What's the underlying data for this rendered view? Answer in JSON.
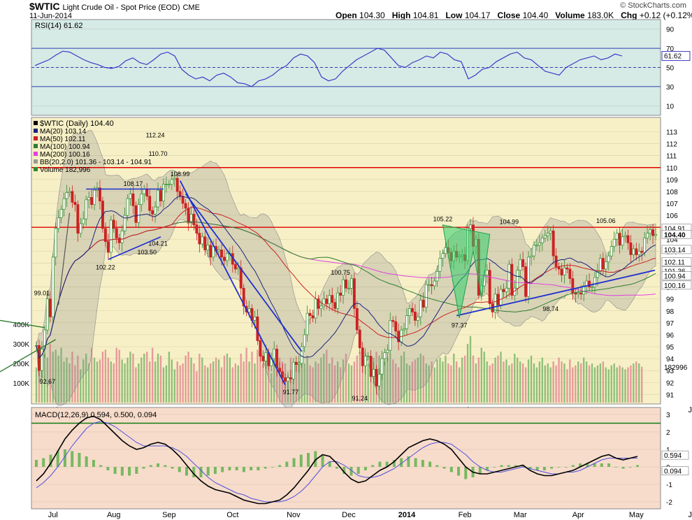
{
  "header": {
    "symbol": "$WTIC",
    "name": "Light Crude Oil - Spot Price (EOD)",
    "exchange": "CME",
    "date": "11-Jun-2014",
    "open_label": "Open",
    "open": "104.30",
    "high_label": "High",
    "high": "104.81",
    "low_label": "Low",
    "low": "104.17",
    "close_label": "Close",
    "close": "104.40",
    "volume_label": "Volume",
    "volume": "183.0K",
    "chg_label": "Chg",
    "chg": "+0.12 (+0.12%)",
    "copyright": "© StockCharts.com"
  },
  "colors": {
    "rsi_bg": "#d6ebe6",
    "price_bg": "#f7f0c6",
    "macd_bg": "#f7dccb",
    "up": "#2e8b2e",
    "down": "#cc2222",
    "ma20": "#1a237e",
    "ma50": "#cc2222",
    "ma100": "#2e7d32",
    "ma200": "#e040e0",
    "trend": "#1f2fd0",
    "pattern": "#2fd06a",
    "volume_up": "#8fbf7a",
    "volume_down": "#e59a9a",
    "band": "#9a9a9a",
    "hline": "#e00000"
  },
  "chart_data": [
    {
      "type": "line",
      "panel": "rsi",
      "title": "RSI(14) 61.62",
      "ylim": [
        0,
        100
      ],
      "ticks": [
        "90",
        "70",
        "50",
        "30",
        "10"
      ],
      "tick_values": [
        90,
        70,
        50,
        30,
        10
      ],
      "reference_lines": [
        70,
        50,
        30
      ],
      "last_value": "61.62",
      "values": [
        52,
        55,
        58,
        63,
        67,
        66,
        62,
        58,
        55,
        53,
        50,
        49,
        51,
        57,
        60,
        55,
        53,
        58,
        64,
        66,
        62,
        48,
        42,
        38,
        40,
        36,
        42,
        44,
        40,
        34,
        33,
        30,
        36,
        38,
        42,
        48,
        52,
        60,
        64,
        62,
        55,
        40,
        36,
        38,
        46,
        52,
        58,
        62,
        66,
        70,
        68,
        60,
        52,
        50,
        55,
        58,
        62,
        60,
        66,
        64,
        58,
        56,
        38,
        42,
        48,
        50,
        56,
        60,
        64,
        66,
        60,
        58,
        52,
        46,
        44,
        42,
        50,
        54,
        58,
        60,
        62,
        58,
        60,
        64,
        62
      ]
    },
    {
      "type": "candlestick",
      "panel": "price",
      "title": "$WTIC (Daily) 104.40",
      "ylim": [
        90.2,
        114.2
      ],
      "ticks": [
        "113",
        "112",
        "111",
        "110",
        "109",
        "108",
        "107",
        "106",
        "105",
        "104",
        "103",
        "102",
        "101",
        "100",
        "99",
        "98",
        "97",
        "96",
        "95",
        "94",
        "93",
        "92",
        "91"
      ],
      "tick_values": [
        113,
        112,
        111,
        110,
        109,
        108,
        107,
        106,
        105,
        104,
        103,
        102,
        101,
        100,
        99,
        98,
        97,
        96,
        95,
        94,
        93,
        92,
        91
      ],
      "x_labels": [
        "Jul",
        "Aug",
        "Sep",
        "Oct",
        "Nov",
        "Dec",
        "2014",
        "Feb",
        "Mar",
        "Apr",
        "May",
        "Jun"
      ],
      "x_label_index": [
        6,
        28,
        48,
        71,
        93,
        113,
        134,
        155,
        175,
        196,
        217,
        238
      ],
      "legend": [
        {
          "label": "$WTIC (Daily) 104.40",
          "color": "#000000"
        },
        {
          "label": "MA(20) 103.14",
          "color": "#1a237e"
        },
        {
          "label": "MA(50) 102.11",
          "color": "#cc2222"
        },
        {
          "label": "MA(100) 100.94",
          "color": "#2e7d32"
        },
        {
          "label": "MA(200) 100.16",
          "color": "#e040e0"
        },
        {
          "label": "BB(20,2.0) 101.36 - 103.14 - 104.91",
          "color": "#9a9a9a"
        },
        {
          "label": "Volume 182,996",
          "color": "#2e8b2e"
        }
      ],
      "close": [
        95.1,
        93.0,
        94.8,
        96.4,
        99.0,
        97.5,
        102.5,
        104.9,
        105.8,
        106.5,
        107.4,
        107.9,
        108.0,
        107.1,
        106.9,
        104.5,
        105.3,
        105.7,
        107.3,
        107.5,
        106.9,
        108.1,
        108.3,
        107.2,
        104.9,
        103.8,
        102.9,
        105.6,
        104.9,
        104.1,
        103.7,
        104.7,
        106.0,
        107.4,
        107.8,
        106.8,
        105.4,
        106.9,
        107.8,
        108.2,
        107.6,
        106.4,
        106.1,
        106.7,
        108.1,
        107.2,
        108.6,
        108.6,
        108.6,
        109.0,
        109.1,
        108.0,
        107.6,
        107.0,
        106.6,
        105.4,
        106.1,
        105.2,
        104.5,
        103.6,
        104.2,
        103.1,
        103.5,
        102.5,
        103.4,
        103.0,
        103.1,
        102.5,
        102.2,
        102.8,
        102.8,
        101.9,
        101.5,
        101.6,
        99.9,
        98.4,
        97.9,
        98.2,
        97.2,
        97.5,
        95.5,
        94.2,
        93.8,
        94.5,
        93.4,
        94.0,
        94.8,
        93.2,
        92.9,
        92.4,
        92.1,
        92.4,
        92.3,
        93.7,
        93.5,
        93.6,
        95.0,
        96.0,
        97.8,
        97.6,
        97.4,
        99.0,
        98.2,
        98.4,
        99.0,
        98.6,
        99.3,
        98.7,
        98.2,
        99.5,
        99.3,
        100.6,
        99.9,
        99.9,
        100.7,
        98.2,
        96.4,
        94.9,
        93.4,
        94.2,
        94.2,
        92.5,
        93.1,
        91.7,
        92.7,
        94.0,
        94.5,
        94.7,
        97.2,
        97.1,
        96.3,
        95.4,
        96.4,
        96.5,
        97.6,
        98.2,
        97.9,
        97.2,
        97.5,
        98.9,
        98.3,
        100.2,
        100.2,
        100.1,
        100.5,
        101.3,
        102.4,
        102.8,
        103.3,
        102.9,
        102.2,
        103.0,
        102.5,
        102.6,
        102.7,
        102.2,
        104.9,
        105.2,
        103.4,
        104.0,
        99.3,
        100.1,
        101.0,
        101.4,
        98.6,
        97.9,
        99.4,
        98.5,
        99.8,
        99.6,
        99.9,
        101.9,
        99.3,
        99.9,
        101.4,
        102.3,
        101.7,
        99.2,
        102.5,
        102.6,
        103.5,
        103.5,
        103.7,
        104.1,
        104.3,
        104.5,
        104.7,
        102.6,
        101.7,
        101.5,
        101.0,
        101.6,
        101.5,
        100.7,
        99.5,
        99.4,
        99.5,
        99.4,
        100.1,
        100.5,
        100.0,
        100.0,
        100.8,
        101.3,
        102.4,
        101.5,
        102.1,
        102.6,
        103.4,
        104.0,
        104.5,
        103.5,
        104.2,
        104.3,
        103.7,
        102.7,
        103.2,
        102.7,
        103.0,
        102.9,
        104.1,
        104.5,
        104.8,
        104.3,
        104.4
      ],
      "annotations": [
        {
          "label": "112.24",
          "index": 43
        },
        {
          "label": "110.70",
          "index": 44
        },
        {
          "label": "108.99",
          "index": 52
        },
        {
          "label": "108.17",
          "index": 35
        },
        {
          "label": "104.21",
          "index": 44
        },
        {
          "label": "103.50",
          "index": 40
        },
        {
          "label": "102.22",
          "index": 25
        },
        {
          "label": "99.01",
          "index": 2
        },
        {
          "label": "92.67",
          "index": 4
        },
        {
          "label": "100.75",
          "index": 110
        },
        {
          "label": "91.77",
          "index": 92
        },
        {
          "label": "91.24",
          "index": 117
        },
        {
          "label": "105.22",
          "index": 147
        },
        {
          "label": "97.37",
          "index": 153
        },
        {
          "label": "104.99",
          "index": 171
        },
        {
          "label": "98.74",
          "index": 186
        },
        {
          "label": "105.06",
          "index": 206
        }
      ],
      "horizontal_lines": [
        110.0,
        105.0
      ],
      "right_labels": [
        {
          "label": "104.91",
          "value": 104.91
        },
        {
          "label": "104.40",
          "value": 104.4,
          "bold": true
        },
        {
          "label": "103.14",
          "value": 103.14
        },
        {
          "label": "102.11",
          "value": 102.11
        },
        {
          "label": "101.36",
          "value": 101.36
        },
        {
          "label": "100.94",
          "value": 100.94
        },
        {
          "label": "100.16",
          "value": 100.16
        }
      ],
      "volume": {
        "ticks": [
          "400K",
          "300K",
          "200K",
          "100K"
        ],
        "tick_values": [
          400,
          300,
          200,
          100
        ],
        "last_label": "182996",
        "values_k": [
          180,
          240,
          200,
          250,
          230,
          300,
          260,
          270,
          240,
          280,
          210,
          230,
          200,
          260,
          190,
          240,
          170,
          220,
          250,
          200,
          280,
          230,
          210,
          220,
          260,
          270,
          230,
          210,
          200,
          280,
          270,
          220,
          200,
          230,
          260,
          250,
          180,
          200,
          230,
          250,
          260,
          210,
          280,
          210,
          250,
          240,
          180,
          190,
          260,
          220,
          170,
          210,
          190,
          200,
          240,
          260,
          230,
          200,
          160,
          250,
          230,
          190,
          180,
          200,
          210,
          230,
          220,
          180,
          240,
          250,
          230,
          180,
          200,
          190,
          250,
          210,
          280,
          210,
          260,
          200,
          270,
          240,
          200,
          230,
          190,
          150,
          220,
          250,
          230,
          210,
          200,
          140,
          230,
          200,
          190,
          210,
          220,
          200,
          240,
          190,
          180,
          210,
          200,
          230,
          250,
          270,
          200,
          230,
          190,
          210,
          180,
          220,
          250,
          200,
          190,
          210,
          240,
          260,
          230,
          250,
          200,
          180,
          230,
          260,
          240,
          200,
          210,
          230,
          250,
          220,
          200,
          180,
          240,
          260,
          200,
          190,
          210,
          220,
          230,
          250,
          240,
          200,
          190,
          210,
          180,
          220,
          230,
          210,
          240,
          200,
          190,
          250,
          210,
          180,
          230,
          240,
          300,
          340,
          240,
          200,
          230,
          280,
          260,
          210,
          190,
          200,
          230,
          240,
          260,
          210,
          220,
          190,
          200,
          250,
          230,
          210,
          200,
          180,
          220,
          240,
          200,
          180,
          210,
          230,
          190,
          200,
          180,
          210,
          190,
          230,
          210,
          200,
          170,
          220,
          180,
          190,
          210,
          200,
          230,
          210,
          190,
          200,
          180,
          190,
          200,
          210,
          180,
          170,
          190,
          200,
          180,
          190,
          180,
          170,
          180,
          190,
          200,
          210,
          200,
          183
        ]
      }
    },
    {
      "type": "line",
      "panel": "macd",
      "title": "MACD(12,26,9) 0.594, 0.500, 0.094",
      "ylim": [
        -2.4,
        3.4
      ],
      "ticks": [
        "3",
        "2",
        "1",
        "0",
        "-1",
        "-2"
      ],
      "tick_values": [
        3,
        2,
        1,
        0,
        -1,
        -2
      ],
      "reference_line": 2.5,
      "right_labels": [
        {
          "label": "0.594",
          "value": 0.594
        },
        {
          "label": "0.094",
          "value": 0.094
        }
      ],
      "x_labels": [
        "Jul",
        "Aug",
        "Sep",
        "Oct",
        "Nov",
        "Dec",
        "2014",
        "Feb",
        "Mar",
        "Apr",
        "May",
        "Jun"
      ],
      "series": [
        {
          "name": "MACD(12,26,9)",
          "values": [
            -0.8,
            -0.4,
            0.2,
            0.9,
            1.6,
            2.1,
            2.5,
            2.8,
            2.9,
            2.7,
            2.3,
            1.9,
            1.5,
            1.2,
            1.0,
            1.1,
            1.3,
            1.4,
            1.3,
            1.0,
            0.6,
            0.1,
            -0.4,
            -0.8,
            -1.1,
            -1.3,
            -1.4,
            -1.5,
            -1.7,
            -1.9,
            -2.0,
            -2.1,
            -2.1,
            -2.0,
            -1.9,
            -1.6,
            -1.2,
            -0.7,
            -0.2,
            0.4,
            0.7,
            0.6,
            0.2,
            -0.3,
            -0.7,
            -0.9,
            -0.8,
            -0.5,
            -0.2,
            0.0,
            0.3,
            0.7,
            1.1,
            1.3,
            1.5,
            1.6,
            1.5,
            1.3,
            1.0,
            0.5,
            0.0,
            -0.3,
            -0.4,
            -0.4,
            -0.3,
            -0.2,
            -0.1,
            0.0,
            0.1,
            -0.2,
            -0.4,
            -0.5,
            -0.5,
            -0.4,
            -0.3,
            -0.2,
            0.0,
            0.2,
            0.4,
            0.6,
            0.7,
            0.5,
            0.4,
            0.5,
            0.6
          ]
        },
        {
          "name": "Signal",
          "values": [
            -1.2,
            -0.9,
            -0.5,
            0.0,
            0.6,
            1.2,
            1.7,
            2.2,
            2.5,
            2.6,
            2.5,
            2.3,
            2.0,
            1.7,
            1.4,
            1.2,
            1.2,
            1.2,
            1.2,
            1.1,
            0.9,
            0.6,
            0.2,
            -0.2,
            -0.6,
            -0.9,
            -1.1,
            -1.3,
            -1.5,
            -1.6,
            -1.8,
            -1.9,
            -2.0,
            -2.0,
            -2.0,
            -1.9,
            -1.7,
            -1.4,
            -1.0,
            -0.5,
            0.0,
            0.3,
            0.3,
            0.1,
            -0.2,
            -0.5,
            -0.6,
            -0.6,
            -0.5,
            -0.3,
            -0.1,
            0.2,
            0.5,
            0.8,
            1.1,
            1.3,
            1.4,
            1.4,
            1.3,
            1.0,
            0.7,
            0.3,
            0.0,
            -0.2,
            -0.3,
            -0.3,
            -0.2,
            -0.1,
            0.0,
            -0.1,
            -0.2,
            -0.3,
            -0.4,
            -0.4,
            -0.3,
            -0.3,
            -0.2,
            0.0,
            0.2,
            0.4,
            0.5,
            0.5,
            0.5,
            0.5,
            0.5
          ]
        }
      ]
    }
  ]
}
